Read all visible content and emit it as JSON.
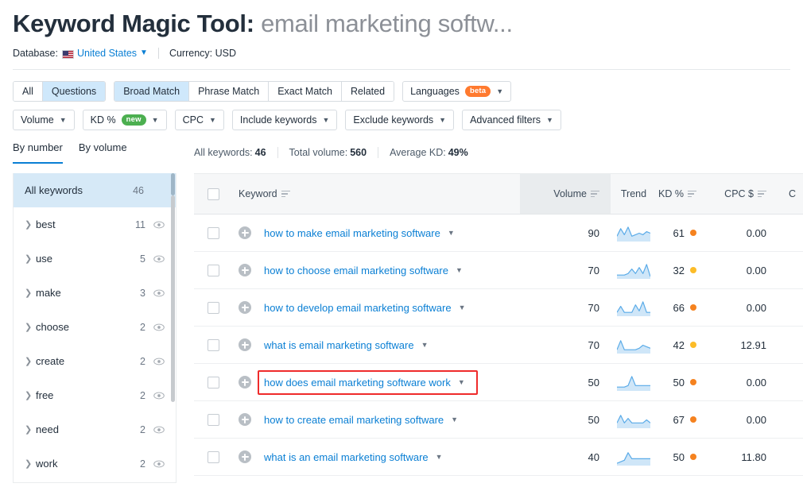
{
  "header": {
    "title_main": "Keyword Magic Tool:",
    "title_query": "email marketing softw...",
    "database_label": "Database:",
    "database_value": "United States",
    "currency_label": "Currency: USD",
    "flag_icon": "us-flag-icon",
    "caret_icon": "chevron-down-icon"
  },
  "filters": {
    "match_group": [
      {
        "label": "All",
        "active": false
      },
      {
        "label": "Questions",
        "active": true
      }
    ],
    "type_group": [
      {
        "label": "Broad Match",
        "active": true
      },
      {
        "label": "Phrase Match",
        "active": false
      },
      {
        "label": "Exact Match",
        "active": false
      },
      {
        "label": "Related",
        "active": false
      }
    ],
    "languages": {
      "label": "Languages",
      "badge": "beta",
      "badge_color": "#ff7a2f"
    },
    "row2": [
      {
        "label": "Volume",
        "badge": null
      },
      {
        "label": "KD %",
        "badge": "new",
        "badge_color": "#4caf50"
      },
      {
        "label": "CPC",
        "badge": null
      },
      {
        "label": "Include keywords",
        "badge": null
      },
      {
        "label": "Exclude keywords",
        "badge": null
      },
      {
        "label": "Advanced filters",
        "badge": null
      }
    ]
  },
  "sidebar": {
    "tabs": [
      {
        "label": "By number",
        "active": true
      },
      {
        "label": "By volume",
        "active": false
      }
    ],
    "all_keywords": {
      "label": "All keywords",
      "count": "46"
    },
    "groups": [
      {
        "label": "best",
        "count": "11"
      },
      {
        "label": "use",
        "count": "5"
      },
      {
        "label": "make",
        "count": "3"
      },
      {
        "label": "choose",
        "count": "2"
      },
      {
        "label": "create",
        "count": "2"
      },
      {
        "label": "free",
        "count": "2"
      },
      {
        "label": "need",
        "count": "2"
      },
      {
        "label": "work",
        "count": "2"
      }
    ]
  },
  "stats": {
    "all_keywords_label": "All keywords:",
    "all_keywords_value": "46",
    "total_volume_label": "Total volume:",
    "total_volume_value": "560",
    "average_kd_label": "Average KD:",
    "average_kd_value": "49%"
  },
  "table": {
    "columns": {
      "keyword": "Keyword",
      "volume": "Volume",
      "trend": "Trend",
      "kd": "KD %",
      "cpc": "CPC $",
      "com": "C"
    },
    "sorted_column": "volume",
    "rows": [
      {
        "keyword": "how to make email marketing software",
        "volume": "90",
        "kd": "61",
        "kd_color": "#f5821f",
        "cpc": "0.00",
        "highlight": false,
        "trend": [
          3,
          8,
          4,
          9,
          3,
          4,
          5,
          4,
          6,
          5
        ]
      },
      {
        "keyword": "how to choose email marketing software",
        "volume": "70",
        "kd": "32",
        "kd_color": "#fcbc28",
        "cpc": "0.00",
        "highlight": false,
        "trend": [
          2,
          2,
          2,
          3,
          6,
          3,
          7,
          3,
          9,
          1
        ]
      },
      {
        "keyword": "how to develop email marketing software",
        "volume": "70",
        "kd": "66",
        "kd_color": "#f5821f",
        "cpc": "0.00",
        "highlight": false,
        "trend": [
          2,
          6,
          2,
          2,
          2,
          7,
          3,
          9,
          2,
          2
        ]
      },
      {
        "keyword": "what is email marketing software",
        "volume": "70",
        "kd": "42",
        "kd_color": "#fcbc28",
        "cpc": "12.91",
        "highlight": false,
        "trend": [
          2,
          8,
          2,
          2,
          2,
          2,
          3,
          5,
          4,
          3
        ]
      },
      {
        "keyword": "how does email marketing software work",
        "volume": "50",
        "kd": "50",
        "kd_color": "#f5821f",
        "cpc": "0.00",
        "highlight": true,
        "trend": [
          2,
          2,
          2,
          3,
          9,
          3,
          3,
          3,
          3,
          3
        ]
      },
      {
        "keyword": "how to create email marketing software",
        "volume": "50",
        "kd": "67",
        "kd_color": "#f5821f",
        "cpc": "0.00",
        "highlight": false,
        "trend": [
          3,
          8,
          3,
          6,
          3,
          3,
          3,
          3,
          5,
          3
        ]
      },
      {
        "keyword": "what is an email marketing software",
        "volume": "40",
        "kd": "50",
        "kd_color": "#f5821f",
        "cpc": "11.80",
        "highlight": false,
        "trend": [
          1,
          2,
          3,
          8,
          4,
          4,
          4,
          4,
          4,
          4
        ]
      }
    ]
  },
  "colors": {
    "link": "#0a7fd4",
    "active_filter": "#cfe8fb",
    "sidebar_active": "#d6e9f7",
    "highlight_border": "#ef2b2b"
  }
}
